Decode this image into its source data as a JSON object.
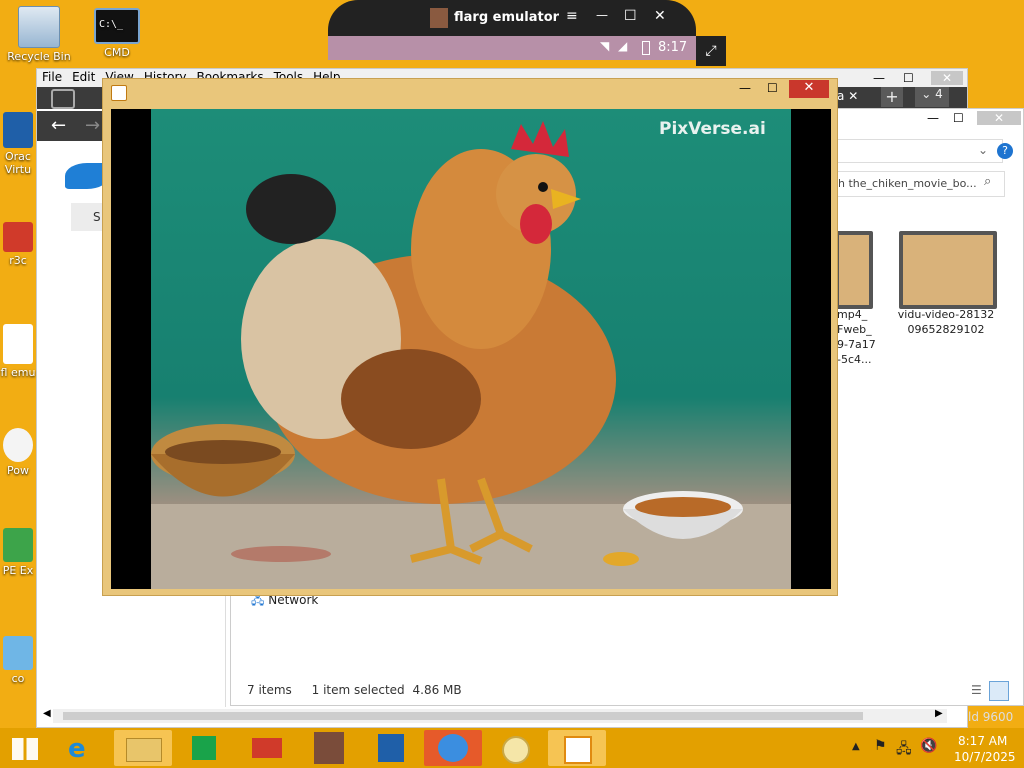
{
  "desktop": {
    "icons": [
      {
        "label": "Recycle Bin",
        "icon": "recycle-bin-icon"
      },
      {
        "label": "CMD",
        "icon": "cmd-icon"
      },
      {
        "label": "Orac Virtu",
        "icon": "virtualbox-icon"
      },
      {
        "label": "r3c",
        "icon": "r3c-icon"
      },
      {
        "label": "fl emu",
        "icon": "flarg-emulator-icon"
      },
      {
        "label": "Pow",
        "icon": "powershell-icon"
      },
      {
        "label": "PE Ex",
        "icon": "pe-explorer-icon"
      },
      {
        "label": "co",
        "icon": "control-icon"
      }
    ]
  },
  "emulator": {
    "title": "flarg emulator",
    "time": "8:17",
    "controls": [
      "≡",
      "—",
      "☐",
      "✕"
    ]
  },
  "browser": {
    "menu": [
      "File",
      "Edit",
      "View",
      "History",
      "Bookmarks",
      "Tools",
      "Help"
    ],
    "tab_count": "4",
    "partial_button": "S",
    "tab_fragment": "a"
  },
  "explorer": {
    "search_placeholder": "h the_chiken_movie_bo...",
    "files": [
      {
        "name": "mp4_ Fweb_ 9-7a17 -5c4..."
      },
      {
        "name": "vidu-video-28132 09652829102"
      }
    ],
    "nav_network": "Network",
    "status_items": "7 items",
    "status_selected": "1 item selected",
    "status_size": "4.86 MB"
  },
  "player": {
    "watermark": "PixVerse.ai"
  },
  "tray": {
    "time": "8:17 AM",
    "date": "10/7/2025",
    "watermark": "ld 9600"
  },
  "colors": {
    "desktop": "#f2ad13",
    "taskbar": "#e3a000",
    "player_frame": "#e9c67b",
    "scene_bg": "#1d8d78"
  }
}
